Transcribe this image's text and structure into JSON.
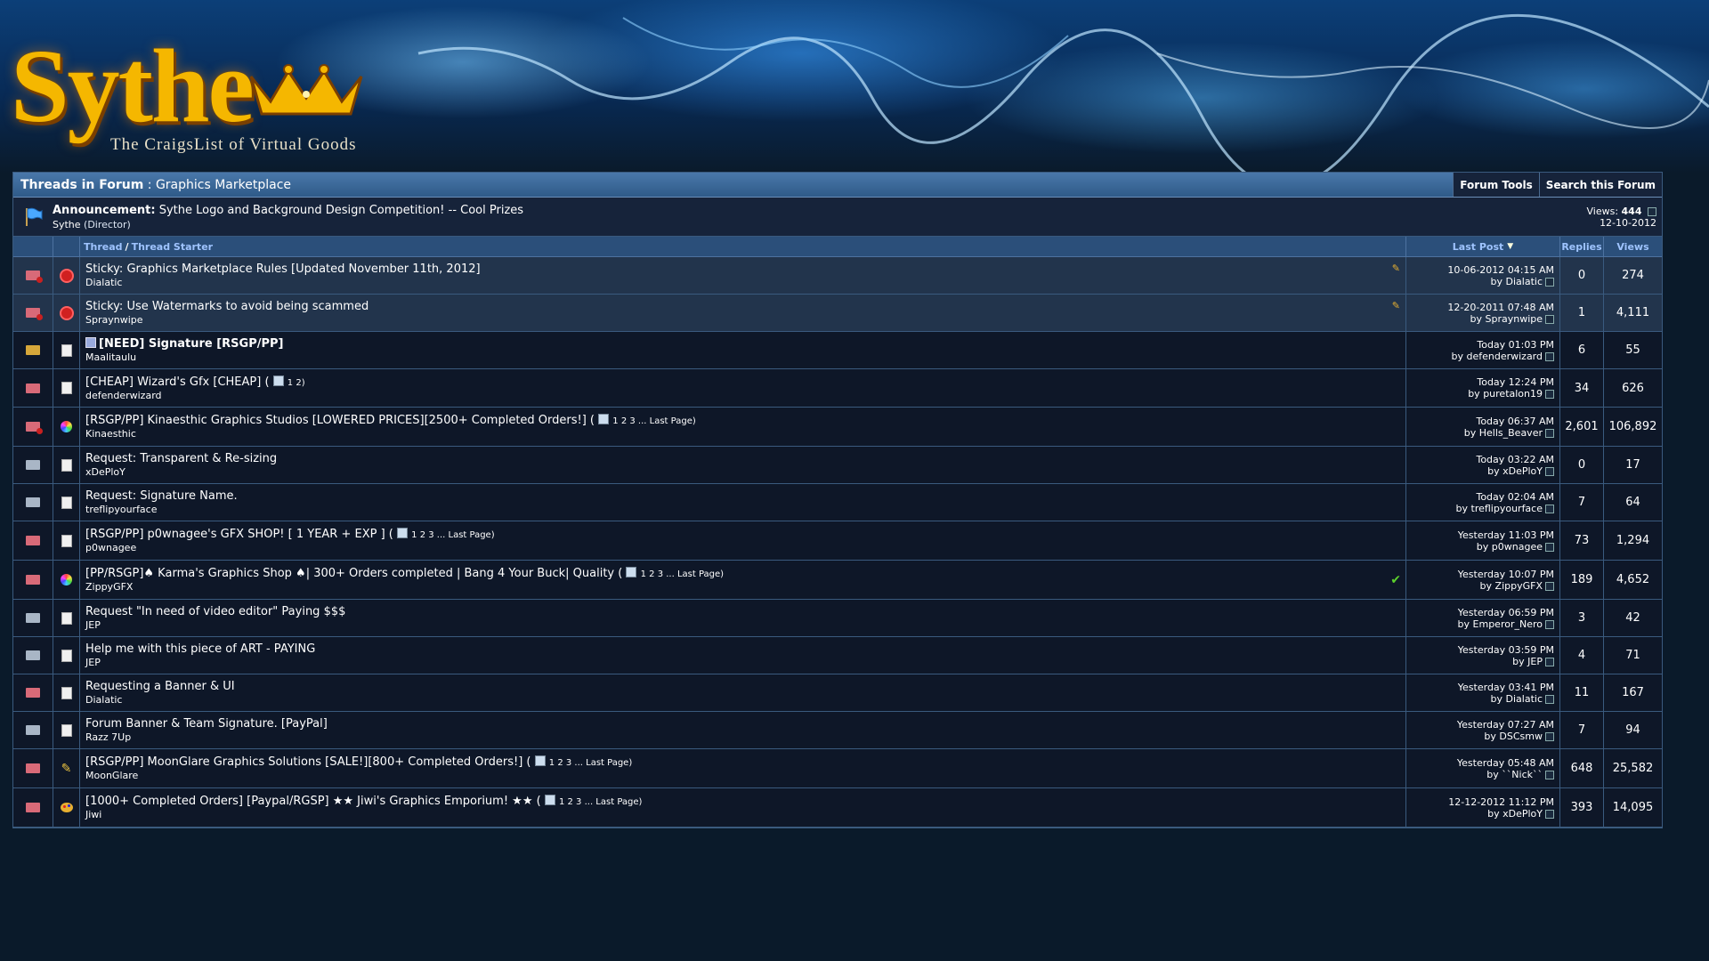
{
  "logo": {
    "name": "Sythe",
    "tagline": "The CraigsList of Virtual Goods"
  },
  "forum_header": {
    "prefix": "Threads in Forum",
    "separator": ":",
    "forum_name": "Graphics Marketplace",
    "tools": [
      "Forum Tools",
      "Search this Forum"
    ]
  },
  "announcement": {
    "label": "Announcement:",
    "title": "Sythe Logo and Background Design Competition! -- Cool Prizes",
    "author": "Sythe",
    "author_role": "(Director)",
    "views_label": "Views:",
    "views": "444",
    "date": "12-10-2012"
  },
  "columns": {
    "thread": "Thread",
    "sep": "/",
    "starter": "Thread Starter",
    "last_post": "Last Post",
    "replies": "Replies",
    "views": "Views"
  },
  "threads": [
    {
      "prefix": "Sticky:",
      "title": "Graphics Marketplace Rules [Updated November 11th, 2012]",
      "starter": "Dialatic",
      "last_date": "10-06-2012 04:15 AM",
      "last_by": "Dialatic",
      "replies": "0",
      "views": "274",
      "pages": ""
    },
    {
      "prefix": "Sticky:",
      "title": "Use Watermarks to avoid being scammed",
      "starter": "Spraynwipe",
      "last_date": "12-20-2011 07:48 AM",
      "last_by": "Spraynwipe",
      "replies": "1",
      "views": "4,111",
      "pages": ""
    },
    {
      "prefix": "",
      "title": "[NEED] Signature [RSGP/PP]",
      "starter": "Maalitaulu",
      "last_date": "Today 01:03 PM",
      "last_by": "defenderwizard",
      "replies": "6",
      "views": "55",
      "pages": ""
    },
    {
      "prefix": "",
      "title": "[CHEAP] Wizard's Gfx [CHEAP] (",
      "starter": "defenderwizard",
      "last_date": "Today 12:24 PM",
      "last_by": "puretalon19",
      "replies": "34",
      "views": "626",
      "pages": "1 2)"
    },
    {
      "prefix": "",
      "title": "[RSGP/PP] Kinaesthic Graphics Studios [LOWERED PRICES][2500+ Completed Orders!] (",
      "starter": "Kinaesthic",
      "last_date": "Today 06:37 AM",
      "last_by": "Hells_Beaver",
      "replies": "2,601",
      "views": "106,892",
      "pages": "1 2 3 ... Last Page)"
    },
    {
      "prefix": "",
      "title": "Request: Transparent & Re-sizing",
      "starter": "xDePloY",
      "last_date": "Today 03:22 AM",
      "last_by": "xDePloY",
      "replies": "0",
      "views": "17",
      "pages": ""
    },
    {
      "prefix": "",
      "title": "Request: Signature Name.",
      "starter": "treflipyourface",
      "last_date": "Today 02:04 AM",
      "last_by": "treflipyourface",
      "replies": "7",
      "views": "64",
      "pages": ""
    },
    {
      "prefix": "",
      "title": "[RSGP/PP] p0wnagee's GFX SHOP! [ 1 YEAR + EXP ] (",
      "starter": "p0wnagee",
      "last_date": "Yesterday 11:03 PM",
      "last_by": "p0wnagee",
      "replies": "73",
      "views": "1,294",
      "pages": "1 2 3 ... Last Page)"
    },
    {
      "prefix": "",
      "title": "[PP/RSGP]♠ Karma's Graphics Shop ♠| 300+ Orders completed | Bang 4 Your Buck| Quality (",
      "starter": "ZippyGFX",
      "last_date": "Yesterday 10:07 PM",
      "last_by": "ZippyGFX",
      "replies": "189",
      "views": "4,652",
      "pages": "1 2 3 ... Last Page)"
    },
    {
      "prefix": "",
      "title": "Request \"In need of video editor\" Paying $$$",
      "starter": "JEP",
      "last_date": "Yesterday 06:59 PM",
      "last_by": "Emperor_Nero",
      "replies": "3",
      "views": "42",
      "pages": ""
    },
    {
      "prefix": "",
      "title": "Help me with this piece of ART - PAYING",
      "starter": "JEP",
      "last_date": "Yesterday 03:59 PM",
      "last_by": "JEP",
      "replies": "4",
      "views": "71",
      "pages": ""
    },
    {
      "prefix": "",
      "title": "Requesting a Banner & UI",
      "starter": "Dialatic",
      "last_date": "Yesterday 03:41 PM",
      "last_by": "Dialatic",
      "replies": "11",
      "views": "167",
      "pages": ""
    },
    {
      "prefix": "",
      "title": "Forum Banner & Team Signature. [PayPal]",
      "starter": "Razz 7Up",
      "last_date": "Yesterday 07:27 AM",
      "last_by": "DSCsmw",
      "replies": "7",
      "views": "94",
      "pages": ""
    },
    {
      "prefix": "",
      "title": "[RSGP/PP] MoonGlare Graphics Solutions [SALE!][800+ Completed Orders!] (",
      "starter": "MoonGlare",
      "last_date": "Yesterday 05:48 AM",
      "last_by": "``Nick``",
      "replies": "648",
      "views": "25,582",
      "pages": "1 2 3 ... Last Page)"
    },
    {
      "prefix": "",
      "title": "[1000+ Completed Orders] [Paypal/RGSP] ★★ Jiwi's Graphics Emporium! ★★ (",
      "starter": "Jiwi",
      "last_date": "12-12-2012 11:12 PM",
      "last_by": "xDePloY",
      "replies": "393",
      "views": "14,095",
      "pages": "1 2 3 ... Last Page)"
    }
  ],
  "by_label": "by"
}
